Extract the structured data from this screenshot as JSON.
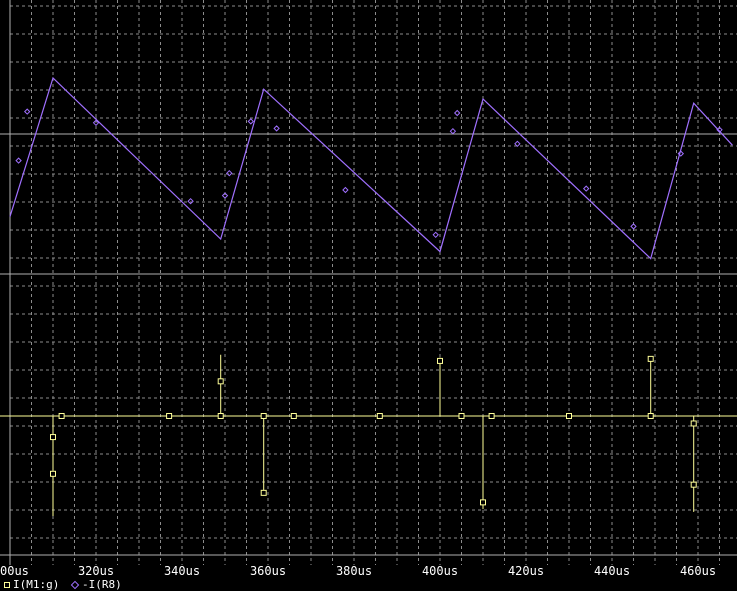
{
  "chart_data": {
    "type": "line",
    "xlabel": "",
    "ylabel": "",
    "x_ticks": [
      "00us",
      "320us",
      "340us",
      "360us",
      "380us",
      "400us",
      "420us",
      "440us",
      "460us"
    ],
    "xlim": [
      300,
      468
    ],
    "grid": true,
    "colors": {
      "background": "#000000",
      "grid": "#8c8c8c",
      "series1": "#ffff99",
      "series2": "#a070ff",
      "text": "#ffffff"
    },
    "series": [
      {
        "name": "I(M1:g)",
        "marker": "square",
        "color": "#ffff99",
        "ylim": [
          -1.0,
          1.0
        ],
        "segments": [
          [
            [
              310,
              -1.47
            ],
            [
              310,
              0
            ]
          ],
          [
            [
              349,
              0
            ],
            [
              349,
              0.9
            ],
            [
              349,
              0
            ]
          ],
          [
            [
              359,
              0
            ],
            [
              359,
              -1.13
            ],
            [
              359,
              0
            ]
          ],
          [
            [
              400,
              0
            ],
            [
              400,
              0.86
            ],
            [
              400,
              0
            ]
          ],
          [
            [
              410,
              0
            ],
            [
              410,
              -1.37
            ],
            [
              410,
              0
            ]
          ],
          [
            [
              449,
              0
            ],
            [
              449,
              0.86
            ],
            [
              449,
              0
            ]
          ],
          [
            [
              459,
              0
            ],
            [
              459,
              -1.41
            ],
            [
              459,
              0
            ]
          ]
        ],
        "baseline": [
          [
            300,
            0
          ],
          [
            468,
            0
          ]
        ],
        "points": [
          [
            310,
            -0.31
          ],
          [
            310,
            -0.85
          ],
          [
            312,
            0
          ],
          [
            337,
            0
          ],
          [
            349,
            0
          ],
          [
            349,
            0.51
          ],
          [
            359,
            0
          ],
          [
            359,
            -1.13
          ],
          [
            366,
            0
          ],
          [
            386,
            0
          ],
          [
            400,
            0.81
          ],
          [
            405,
            0
          ],
          [
            410,
            -1.27
          ],
          [
            412,
            0
          ],
          [
            430,
            0
          ],
          [
            449,
            0.84
          ],
          [
            449,
            0
          ],
          [
            459,
            -0.11
          ],
          [
            459,
            -1.01
          ]
        ]
      },
      {
        "name": "-I(R8)",
        "marker": "diamond",
        "color": "#a070ff",
        "ylim": [
          -1.0,
          1.0
        ],
        "values": [
          [
            300,
            -0.09
          ],
          [
            310,
            0.9
          ],
          [
            349,
            -0.25
          ],
          [
            359,
            0.82
          ],
          [
            400,
            -0.34
          ],
          [
            410,
            0.75
          ],
          [
            449,
            -0.39
          ],
          [
            459,
            0.72
          ],
          [
            468,
            0.42
          ]
        ],
        "points": [
          [
            302,
            0.31
          ],
          [
            304,
            0.66
          ],
          [
            320,
            0.58
          ],
          [
            342,
            0.02
          ],
          [
            350,
            0.06
          ],
          [
            351,
            0.22
          ],
          [
            356,
            0.59
          ],
          [
            362,
            0.54
          ],
          [
            378,
            0.1
          ],
          [
            399,
            -0.22
          ],
          [
            403,
            0.52
          ],
          [
            404,
            0.65
          ],
          [
            418,
            0.43
          ],
          [
            434,
            0.11
          ],
          [
            445,
            -0.16
          ],
          [
            456,
            0.36
          ],
          [
            465,
            0.53
          ]
        ]
      }
    ]
  },
  "legend": {
    "s1": "I(M1:g)",
    "s2": "-I(R8)"
  }
}
